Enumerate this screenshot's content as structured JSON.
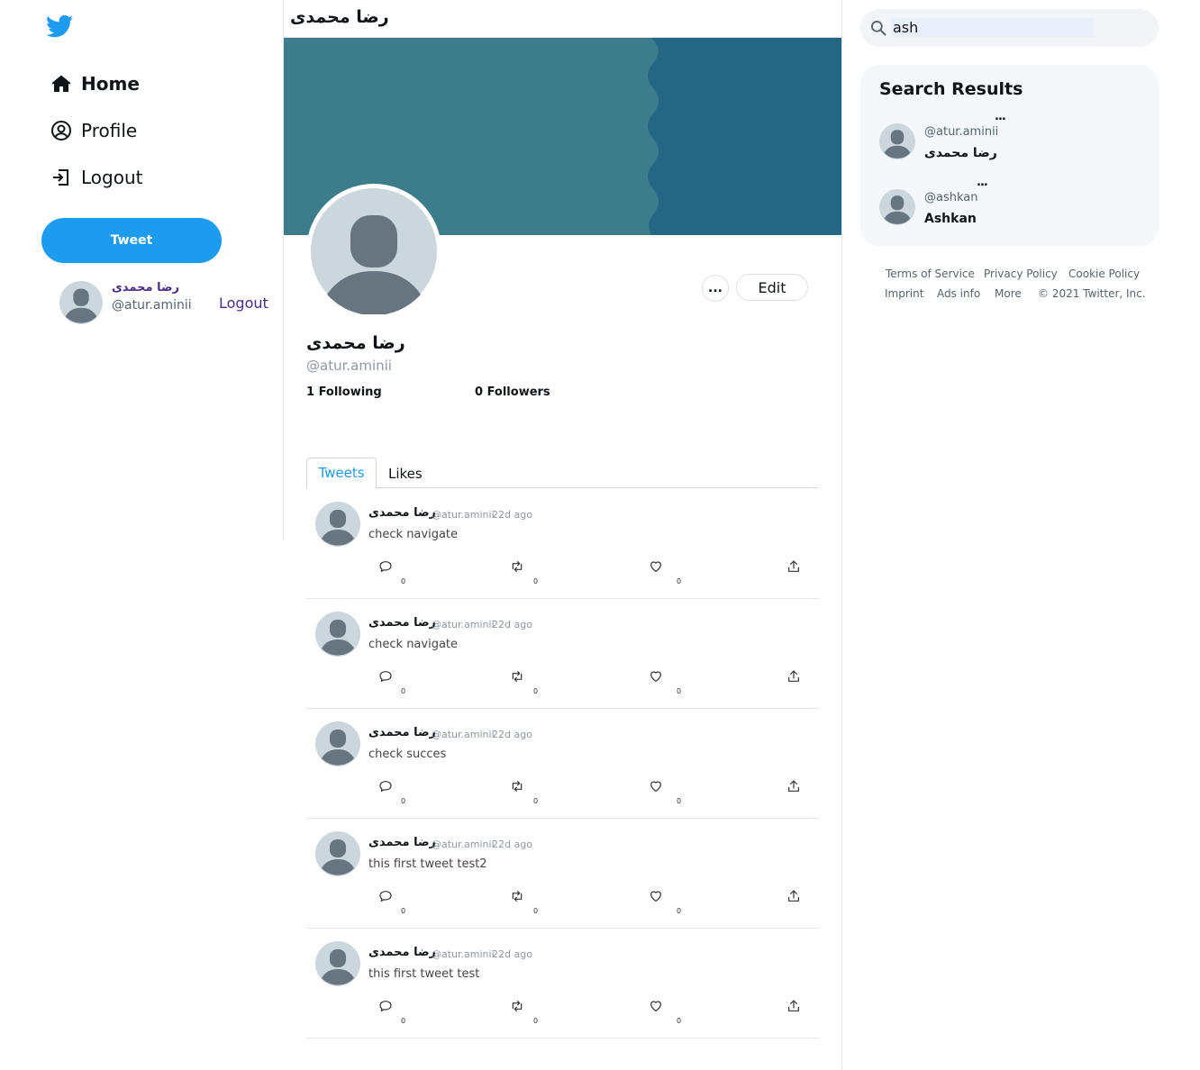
{
  "sidebar": {
    "nav": [
      {
        "label": "Home",
        "icon": "home-icon"
      },
      {
        "label": "Profile",
        "icon": "profile-icon"
      },
      {
        "label": "Logout",
        "icon": "logout-icon"
      }
    ],
    "tweet_button": "Tweet",
    "account": {
      "name": "رضا محمدی",
      "handle": "@atur.aminii",
      "logout": "Logout"
    }
  },
  "header": {
    "title": "رضا محمدی"
  },
  "profile": {
    "name": "رضا محمدی",
    "handle": "@atur.aminii",
    "more_label": "...",
    "edit_label": "Edit",
    "following": "1 Following",
    "followers": "0 Followers",
    "banner_colors": {
      "left": "#3d7d8b",
      "right": "#246785"
    }
  },
  "tabs": [
    {
      "label": "Tweets",
      "active": true
    },
    {
      "label": "Likes",
      "active": false
    }
  ],
  "tweets": [
    {
      "name": "رضا محمدی",
      "handle": "@atur.aminii",
      "time": "22d ago",
      "text": "check navigate",
      "replies": "0",
      "retweets": "0",
      "likes": "0"
    },
    {
      "name": "رضا محمدی",
      "handle": "@atur.aminii",
      "time": "22d ago",
      "text": "check navigate",
      "replies": "0",
      "retweets": "0",
      "likes": "0"
    },
    {
      "name": "رضا محمدی",
      "handle": "@atur.aminii",
      "time": "22d ago",
      "text": "check succes",
      "replies": "0",
      "retweets": "0",
      "likes": "0"
    },
    {
      "name": "رضا محمدی",
      "handle": "@atur.aminii",
      "time": "22d ago",
      "text": "this first tweet test2",
      "replies": "0",
      "retweets": "0",
      "likes": "0"
    },
    {
      "name": "رضا محمدی",
      "handle": "@atur.aminii",
      "time": "22d ago",
      "text": "this first tweet test",
      "replies": "0",
      "retweets": "0",
      "likes": "0"
    }
  ],
  "search": {
    "value": "ash"
  },
  "results": {
    "title": "Search Results",
    "items": [
      {
        "handle": "@atur.aminii",
        "name": "رضا محمدی",
        "more": "..."
      },
      {
        "handle": "@ashkan",
        "name": "Ashkan",
        "more": "..."
      }
    ]
  },
  "footer": {
    "links": [
      "Terms of Service",
      "Privacy Policy",
      "Cookie Policy",
      "Imprint",
      "Ads info",
      "More",
      "© 2021 Twitter, Inc."
    ]
  },
  "colors": {
    "accent": "#1d9bf0",
    "account_name": "#4b2a88"
  }
}
